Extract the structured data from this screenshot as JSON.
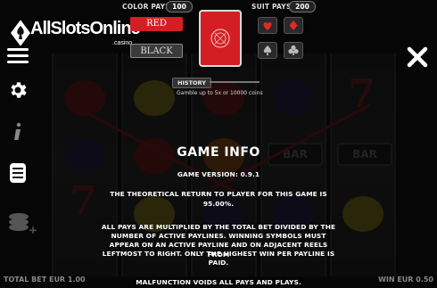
{
  "logo": {
    "text": "AllSlotsOnline",
    "sub": ".casino"
  },
  "gamble": {
    "color_pays_label": "COLOR PAYS",
    "color_pays_value": "100",
    "suit_pays_label": "SUIT PAYS",
    "suit_pays_value": "200",
    "red_label": "RED",
    "black_label": "BLACK",
    "history_label": "HISTORY",
    "note": "Gamble up to 5x or 10000 coins"
  },
  "reels": {
    "bar_label": "BAR"
  },
  "info": {
    "title": "GAME INFO",
    "version": "GAME VERSION: 0.9.1",
    "rtp_line1": "THE THEORETICAL RETURN TO PLAYER FOR THIS GAME IS",
    "rtp_line2": "95.00%.",
    "pays_line1": "ALL PAYS ARE MULTIPLIED BY THE TOTAL BET DIVIDED BY THE",
    "pays_line2": "NUMBER OF ACTIVE PAYLINES. WINNING SYMBOLS MUST",
    "pays_line3": "APPEAR ON AN ACTIVE PAYLINE AND ON ADJACENT REELS FROM",
    "pays_line4": "LEFTMOST TO RIGHT. ONLY THE HIGHEST WIN PER PAYLINE IS",
    "pays_line5": "PAID.",
    "malfunction": "MALFUNCTION VOIDS ALL PAYS AND PLAYS."
  },
  "bottom": {
    "total_bet": "TOTAL BET EUR 1.00",
    "win": "WIN EUR 0.50"
  },
  "colors": {
    "red_button": "#d31f24",
    "card_red": "#d31f24",
    "accent": "#ffffff"
  },
  "icons": [
    "diamond-logo-icon",
    "menu-icon",
    "gear-icon",
    "info-icon",
    "paytable-icon",
    "coins-icon",
    "close-icon",
    "heart-icon",
    "diamond-icon",
    "spade-icon",
    "club-icon"
  ]
}
